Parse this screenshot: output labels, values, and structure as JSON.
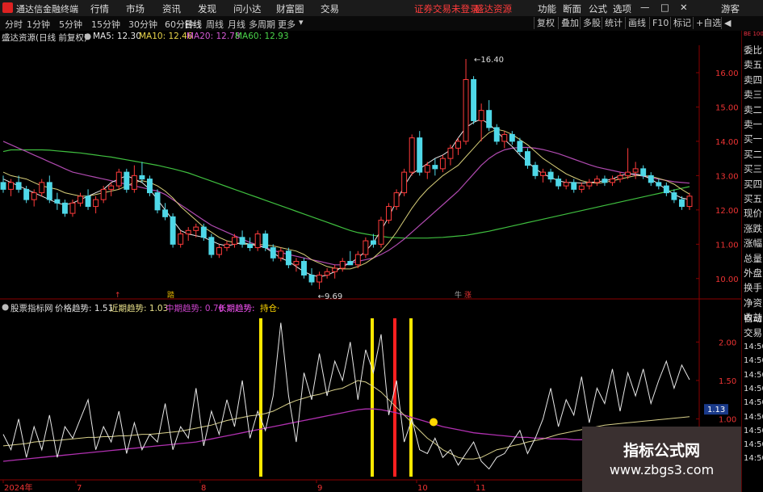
{
  "app": {
    "title": "通达信金融终端",
    "menu": [
      "行情",
      "市场",
      "资讯",
      "发现",
      "问小达",
      "财富圈",
      "交易"
    ],
    "notice1": "证券交易未登录",
    "notice2": "盛达资源",
    "right_menu": [
      "功能",
      "断面",
      "公式",
      "选项"
    ],
    "guest": "游客"
  },
  "toolbar": {
    "periods": [
      "分时",
      "1分钟",
      "5分钟",
      "15分钟",
      "30分钟",
      "60分钟",
      "日线",
      "周线",
      "月线",
      "多周期",
      "更多"
    ],
    "active_period": "日线",
    "right": [
      "复权",
      "叠加",
      "多股",
      "统计",
      "画线",
      "F10",
      "标记",
      "+自选",
      "◀"
    ]
  },
  "main_chart": {
    "legend_title": "盛达资源(日线 前复权)",
    "ma": [
      {
        "label": "MA5:",
        "value": "12.30",
        "color": "#e8e8e8"
      },
      {
        "label": "MA10:",
        "value": "12.46",
        "color": "#e8d44a"
      },
      {
        "label": "MA20:",
        "value": "12.78",
        "color": "#d45ad4"
      },
      {
        "label": "MA60:",
        "value": "12.93",
        "color": "#4ad44a"
      }
    ],
    "high_label": "16.40",
    "low_label": "9.69",
    "yticks": [
      "16.00",
      "15.00",
      "14.00",
      "13.00",
      "12.00",
      "11.00",
      "10.00"
    ],
    "markers": [
      "↑",
      "踏",
      "牛 ",
      "涨"
    ]
  },
  "indicator": {
    "source": "股票指标网",
    "items": [
      {
        "label": "价格趋势:",
        "value": "1.51",
        "color": "#e0e0e0"
      },
      {
        "label": "近期趋势:",
        "value": "1.03",
        "color": "#e8e08a"
      },
      {
        "label": "中期趋势:",
        "value": "0.70",
        "color": "#cc44cc"
      },
      {
        "label": "长期趋势:",
        "value": "",
        "color": "#ff55ff"
      },
      {
        "label": "持仓·",
        "value": "",
        "color": "#ffd700"
      }
    ],
    "yticks": [
      "2.00",
      "1.50",
      "1.00"
    ],
    "current_value": "1.13"
  },
  "xaxis": [
    "2024年",
    "7",
    "8",
    "9",
    "10",
    "11"
  ],
  "side": {
    "top": "BE 100E",
    "items": [
      "委比",
      "卖五",
      "卖四",
      "卖三",
      "卖二",
      "卖一",
      "买一",
      "买二",
      "买三",
      "买四",
      "买五",
      "现价",
      "涨跌",
      "涨幅",
      "总量",
      "外盘",
      "换手",
      "净资",
      "收益",
      "自动",
      "交易",
      "14:50",
      "14:50",
      "14:50",
      "14:50",
      "14:50",
      "14:50",
      "14:50",
      "14:50",
      "14:50"
    ]
  },
  "watermark": {
    "line1": "指标公式网",
    "line2": "www.zbgs3.com"
  },
  "chart_data": {
    "type": "candlestick",
    "title": "盛达资源(日线 前复权)",
    "ylim": [
      9.5,
      16.8
    ],
    "candles": [
      [
        12.8,
        13.0,
        12.5,
        12.6
      ],
      [
        12.6,
        12.9,
        12.4,
        12.8
      ],
      [
        12.8,
        13.0,
        12.5,
        12.6
      ],
      [
        12.6,
        12.7,
        12.2,
        12.3
      ],
      [
        12.3,
        12.6,
        12.1,
        12.5
      ],
      [
        12.5,
        12.9,
        12.4,
        12.8
      ],
      [
        12.8,
        13.0,
        12.2,
        12.3
      ],
      [
        12.3,
        12.5,
        12.0,
        12.2
      ],
      [
        12.2,
        12.3,
        11.8,
        11.9
      ],
      [
        11.9,
        12.3,
        11.8,
        12.2
      ],
      [
        12.2,
        12.5,
        12.1,
        12.4
      ],
      [
        12.4,
        12.6,
        12.0,
        12.1
      ],
      [
        12.1,
        12.4,
        11.9,
        12.3
      ],
      [
        12.3,
        12.7,
        12.2,
        12.6
      ],
      [
        12.6,
        12.8,
        12.4,
        12.7
      ],
      [
        12.7,
        13.2,
        12.6,
        13.1
      ],
      [
        13.1,
        13.2,
        12.5,
        12.6
      ],
      [
        12.6,
        13.3,
        12.5,
        13.0
      ],
      [
        13.0,
        13.4,
        12.8,
        12.9
      ],
      [
        12.9,
        13.0,
        12.4,
        12.5
      ],
      [
        12.5,
        12.6,
        11.9,
        12.0
      ],
      [
        12.0,
        12.2,
        11.7,
        11.8
      ],
      [
        11.8,
        11.9,
        10.9,
        11.0
      ],
      [
        11.0,
        11.4,
        10.9,
        11.3
      ],
      [
        11.3,
        11.5,
        11.1,
        11.4
      ],
      [
        11.4,
        11.6,
        11.2,
        11.5
      ],
      [
        11.5,
        11.6,
        11.1,
        11.2
      ],
      [
        11.2,
        11.3,
        10.6,
        10.7
      ],
      [
        10.7,
        11.0,
        10.6,
        10.9
      ],
      [
        10.9,
        11.1,
        10.8,
        11.0
      ],
      [
        11.0,
        11.3,
        10.9,
        11.2
      ],
      [
        11.2,
        11.4,
        10.9,
        11.0
      ],
      [
        11.0,
        11.2,
        10.8,
        10.9
      ],
      [
        10.9,
        11.4,
        10.8,
        11.3
      ],
      [
        11.3,
        11.4,
        10.8,
        10.9
      ],
      [
        10.9,
        11.0,
        10.5,
        10.6
      ],
      [
        10.6,
        10.9,
        10.5,
        10.8
      ],
      [
        10.8,
        10.9,
        10.3,
        10.4
      ],
      [
        10.4,
        10.6,
        10.2,
        10.5
      ],
      [
        10.5,
        10.6,
        10.0,
        10.1
      ],
      [
        10.1,
        10.3,
        9.8,
        9.9
      ],
      [
        9.9,
        10.2,
        9.69,
        10.1
      ],
      [
        10.1,
        10.3,
        10.0,
        10.2
      ],
      [
        10.2,
        10.4,
        10.0,
        10.3
      ],
      [
        10.3,
        10.6,
        10.2,
        10.5
      ],
      [
        10.5,
        10.8,
        10.4,
        10.4
      ],
      [
        10.4,
        10.8,
        10.3,
        10.7
      ],
      [
        10.7,
        11.2,
        10.6,
        11.1
      ],
      [
        11.1,
        11.3,
        10.9,
        11.0
      ],
      [
        11.0,
        11.8,
        10.9,
        11.7
      ],
      [
        11.7,
        12.2,
        11.6,
        12.1
      ],
      [
        12.1,
        12.6,
        12.0,
        12.5
      ],
      [
        12.5,
        13.2,
        12.4,
        13.1
      ],
      [
        13.1,
        14.2,
        13.0,
        14.1
      ],
      [
        14.1,
        14.3,
        13.0,
        13.1
      ],
      [
        13.1,
        13.4,
        12.9,
        13.3
      ],
      [
        13.3,
        13.5,
        13.0,
        13.2
      ],
      [
        13.2,
        13.6,
        13.1,
        13.5
      ],
      [
        13.5,
        13.9,
        13.3,
        13.8
      ],
      [
        13.8,
        14.1,
        13.6,
        14.0
      ],
      [
        14.0,
        16.4,
        13.9,
        15.8
      ],
      [
        15.8,
        15.9,
        14.5,
        14.6
      ],
      [
        14.6,
        15.1,
        14.0,
        14.9
      ],
      [
        14.9,
        15.2,
        14.3,
        14.4
      ],
      [
        14.4,
        14.5,
        13.9,
        14.0
      ],
      [
        14.0,
        14.3,
        13.8,
        14.2
      ],
      [
        14.2,
        14.3,
        13.9,
        14.0
      ],
      [
        14.0,
        14.1,
        13.6,
        13.7
      ],
      [
        13.7,
        13.8,
        13.2,
        13.3
      ],
      [
        13.3,
        13.4,
        12.9,
        13.0
      ],
      [
        13.0,
        13.2,
        12.8,
        13.1
      ],
      [
        13.1,
        13.2,
        12.8,
        12.9
      ],
      [
        12.9,
        13.0,
        12.6,
        12.7
      ],
      [
        12.7,
        12.9,
        12.6,
        12.8
      ],
      [
        12.8,
        12.9,
        12.5,
        12.6
      ],
      [
        12.6,
        12.8,
        12.5,
        12.7
      ],
      [
        12.7,
        12.9,
        12.6,
        12.8
      ],
      [
        12.8,
        13.0,
        12.7,
        12.9
      ],
      [
        12.9,
        13.0,
        12.7,
        12.8
      ],
      [
        12.8,
        13.0,
        12.7,
        12.9
      ],
      [
        12.9,
        13.1,
        12.8,
        13.0
      ],
      [
        13.0,
        13.8,
        12.9,
        13.1
      ],
      [
        13.1,
        13.4,
        12.9,
        13.2
      ],
      [
        13.2,
        13.3,
        12.9,
        13.0
      ],
      [
        13.0,
        13.1,
        12.7,
        12.8
      ],
      [
        12.8,
        12.9,
        12.6,
        12.7
      ],
      [
        12.7,
        12.8,
        12.4,
        12.5
      ],
      [
        12.5,
        12.6,
        12.2,
        12.3
      ],
      [
        12.3,
        12.4,
        12.0,
        12.1
      ],
      [
        12.1,
        12.5,
        12.0,
        12.4
      ]
    ],
    "ma60": [
      13.7,
      13.75,
      13.75,
      13.75,
      13.75,
      13.75,
      13.74,
      13.72,
      13.7,
      13.68,
      13.66,
      13.63,
      13.6,
      13.57,
      13.54,
      13.5,
      13.46,
      13.42,
      13.38,
      13.34,
      13.3,
      13.25,
      13.2,
      13.14,
      13.08,
      13.0,
      12.92,
      12.84,
      12.76,
      12.68,
      12.6,
      12.52,
      12.44,
      12.36,
      12.28,
      12.2,
      12.12,
      12.04,
      11.96,
      11.88,
      11.8,
      11.72,
      11.64,
      11.56,
      11.48,
      11.4,
      11.34,
      11.3,
      11.26,
      11.23,
      11.2,
      11.19,
      11.18,
      11.18,
      11.18,
      11.18,
      11.19,
      11.2,
      11.22,
      11.24,
      11.26,
      11.3,
      11.34,
      11.38,
      11.43,
      11.48,
      11.53,
      11.58,
      11.63,
      11.68,
      11.73,
      11.78,
      11.83,
      11.88,
      11.93,
      11.98,
      12.03,
      12.08,
      12.13,
      12.18,
      12.23,
      12.28,
      12.33,
      12.38,
      12.43,
      12.48,
      12.53,
      12.58,
      12.63,
      12.68
    ],
    "ma20": [
      14.0,
      13.9,
      13.8,
      13.7,
      13.6,
      13.5,
      13.4,
      13.3,
      13.2,
      13.1,
      13.05,
      13.0,
      12.95,
      12.9,
      12.85,
      12.8,
      12.75,
      12.7,
      12.65,
      12.6,
      12.55,
      12.45,
      12.3,
      12.15,
      12.0,
      11.85,
      11.7,
      11.55,
      11.45,
      11.35,
      11.25,
      11.15,
      11.05,
      10.98,
      10.9,
      10.82,
      10.76,
      10.7,
      10.65,
      10.6,
      10.55,
      10.5,
      10.45,
      10.4,
      10.4,
      10.45,
      10.5,
      10.55,
      10.6,
      10.7,
      10.82,
      10.98,
      11.15,
      11.35,
      11.55,
      11.75,
      11.95,
      12.15,
      12.35,
      12.55,
      12.8,
      13.05,
      13.3,
      13.5,
      13.65,
      13.75,
      13.8,
      13.82,
      13.82,
      13.8,
      13.76,
      13.7,
      13.64,
      13.56,
      13.48,
      13.4,
      13.32,
      13.25,
      13.2,
      13.15,
      13.1,
      13.06,
      13.02,
      12.98,
      12.94,
      12.9,
      12.86,
      12.82,
      12.8,
      12.78
    ],
    "ma10": [
      13.1,
      13.0,
      12.95,
      12.9,
      12.8,
      12.7,
      12.65,
      12.6,
      12.5,
      12.45,
      12.4,
      12.4,
      12.45,
      12.5,
      12.55,
      12.6,
      12.7,
      12.8,
      12.85,
      12.8,
      12.7,
      12.55,
      12.35,
      12.1,
      11.9,
      11.7,
      11.5,
      11.35,
      11.2,
      11.1,
      11.05,
      11.0,
      11.0,
      11.0,
      10.98,
      10.95,
      10.9,
      10.85,
      10.8,
      10.7,
      10.55,
      10.45,
      10.35,
      10.3,
      10.28,
      10.28,
      10.35,
      10.45,
      10.6,
      10.8,
      11.05,
      11.35,
      11.7,
      12.05,
      12.35,
      12.6,
      12.8,
      13.0,
      13.15,
      13.3,
      13.55,
      13.8,
      14.05,
      14.25,
      14.35,
      14.3,
      14.2,
      14.05,
      13.9,
      13.7,
      13.5,
      13.35,
      13.2,
      13.05,
      12.95,
      12.85,
      12.8,
      12.78,
      12.8,
      12.85,
      12.9,
      12.95,
      13.0,
      13.0,
      12.98,
      12.92,
      12.85,
      12.75,
      12.6,
      12.46
    ],
    "ma5": [
      12.9,
      12.8,
      12.7,
      12.6,
      12.5,
      12.4,
      12.3,
      12.2,
      12.15,
      12.2,
      12.3,
      12.4,
      12.5,
      12.6,
      12.8,
      12.9,
      13.0,
      12.9,
      12.8,
      12.6,
      12.3,
      12.0,
      11.7,
      11.4,
      11.3,
      11.25,
      11.2,
      11.1,
      11.0,
      10.95,
      11.0,
      11.05,
      11.0,
      10.95,
      10.9,
      10.75,
      10.6,
      10.5,
      10.35,
      10.2,
      10.1,
      10.05,
      10.1,
      10.2,
      10.35,
      10.45,
      10.6,
      10.8,
      11.05,
      11.4,
      11.8,
      12.25,
      12.7,
      13.05,
      13.2,
      13.35,
      13.5,
      13.6,
      13.75,
      14.1,
      14.4,
      14.55,
      14.65,
      14.5,
      14.3,
      14.05,
      13.85,
      13.6,
      13.4,
      13.2,
      13.05,
      12.95,
      12.85,
      12.8,
      12.8,
      12.78,
      12.8,
      12.82,
      12.85,
      12.9,
      13.0,
      13.05,
      13.05,
      13.0,
      12.9,
      12.75,
      12.6,
      12.45,
      12.35,
      12.3
    ],
    "indicator": {
      "ylim": [
        0.25,
        2.35
      ],
      "price_trend": [
        0.8,
        0.6,
        1.0,
        0.5,
        0.9,
        0.6,
        1.05,
        0.5,
        0.9,
        0.75,
        1.0,
        1.25,
        0.6,
        0.9,
        0.7,
        1.1,
        0.55,
        0.95,
        0.6,
        0.8,
        0.7,
        1.2,
        0.6,
        0.9,
        0.75,
        1.4,
        0.65,
        1.1,
        0.8,
        1.25,
        0.9,
        1.5,
        0.75,
        1.1,
        0.85,
        1.3,
        2.25,
        1.3,
        0.7,
        1.6,
        1.25,
        1.85,
        1.3,
        1.75,
        1.5,
        2.0,
        1.25,
        1.9,
        1.6,
        2.1,
        1.05,
        1.5,
        0.7,
        1.0,
        0.6,
        0.55,
        0.75,
        0.5,
        0.6,
        0.4,
        0.55,
        0.7,
        0.45,
        0.35,
        0.5,
        0.55,
        0.7,
        0.85,
        0.55,
        0.75,
        1.0,
        1.4,
        0.9,
        1.25,
        1.05,
        1.55,
        0.95,
        1.4,
        1.2,
        1.65,
        1.1,
        1.6,
        1.3,
        1.65,
        1.2,
        1.5,
        1.75,
        1.4,
        1.7,
        1.51
      ],
      "near_trend": [
        0.65,
        0.66,
        0.67,
        0.68,
        0.7,
        0.71,
        0.72,
        0.72,
        0.73,
        0.74,
        0.75,
        0.76,
        0.76,
        0.77,
        0.77,
        0.78,
        0.78,
        0.79,
        0.8,
        0.8,
        0.81,
        0.82,
        0.83,
        0.84,
        0.86,
        0.88,
        0.9,
        0.92,
        0.95,
        0.98,
        1.0,
        1.02,
        1.04,
        1.05,
        1.07,
        1.1,
        1.15,
        1.2,
        1.24,
        1.27,
        1.3,
        1.32,
        1.35,
        1.38,
        1.4,
        1.45,
        1.5,
        1.48,
        1.42,
        1.35,
        1.25,
        1.15,
        1.05,
        0.95,
        0.85,
        0.75,
        0.68,
        0.6,
        0.55,
        0.5,
        0.48,
        0.48,
        0.5,
        0.55,
        0.6,
        0.62,
        0.65,
        0.67,
        0.7,
        0.72,
        0.74,
        0.77,
        0.8,
        0.82,
        0.84,
        0.86,
        0.88,
        0.9,
        0.92,
        0.93,
        0.94,
        0.95,
        0.96,
        0.97,
        0.98,
        0.99,
        1.0,
        1.01,
        1.02,
        1.03
      ],
      "mid_trend": [
        0.45,
        0.46,
        0.47,
        0.48,
        0.49,
        0.5,
        0.51,
        0.52,
        0.53,
        0.54,
        0.55,
        0.56,
        0.57,
        0.58,
        0.59,
        0.6,
        0.61,
        0.62,
        0.63,
        0.64,
        0.65,
        0.66,
        0.67,
        0.68,
        0.69,
        0.7,
        0.72,
        0.74,
        0.76,
        0.78,
        0.8,
        0.82,
        0.84,
        0.86,
        0.88,
        0.9,
        0.92,
        0.94,
        0.96,
        0.98,
        1.0,
        1.02,
        1.04,
        1.06,
        1.08,
        1.1,
        1.12,
        1.13,
        1.13,
        1.12,
        1.1,
        1.08,
        1.05,
        1.02,
        0.99,
        0.96,
        0.93,
        0.9,
        0.88,
        0.86,
        0.84,
        0.82,
        0.81,
        0.8,
        0.79,
        0.78,
        0.77,
        0.76,
        0.76,
        0.75,
        0.75,
        0.74,
        0.74,
        0.74,
        0.73,
        0.73,
        0.73,
        0.72,
        0.72,
        0.72,
        0.71,
        0.71,
        0.71,
        0.71,
        0.7,
        0.7,
        0.7,
        0.7,
        0.7,
        0.7
      ],
      "yellow_bars": [
        36,
        50,
        56
      ],
      "red_bars": [
        53
      ]
    }
  }
}
